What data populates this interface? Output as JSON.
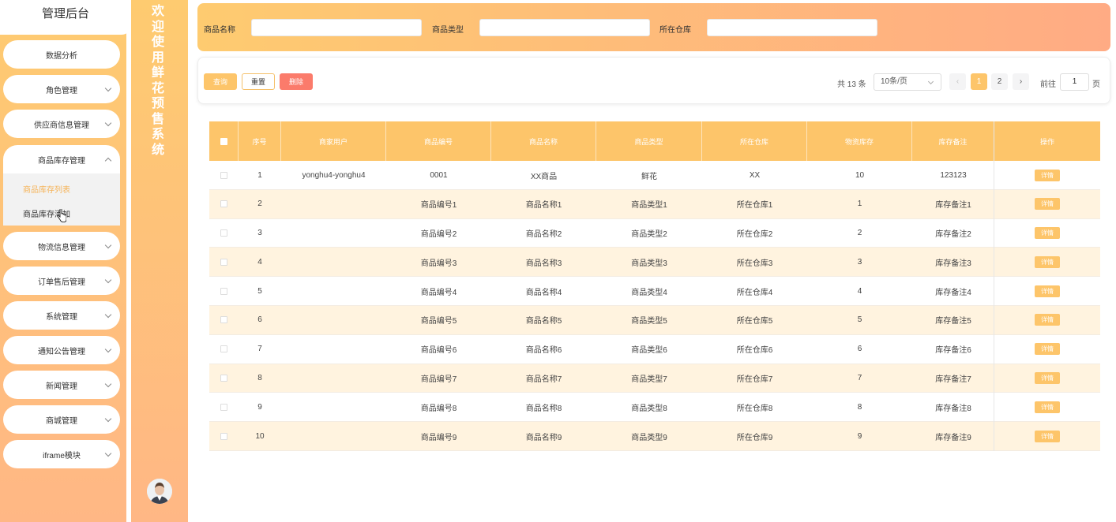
{
  "sidebar": {
    "title": "管理后台",
    "menu": [
      {
        "label": "数据分析",
        "chevron": false
      },
      {
        "label": "角色管理",
        "chevron": true
      },
      {
        "label": "供应商信息管理",
        "chevron": true
      },
      {
        "label": "商品库存管理",
        "chevron": true,
        "open": true
      },
      {
        "label": "物流信息管理",
        "chevron": true
      },
      {
        "label": "订单售后管理",
        "chevron": true
      },
      {
        "label": "系统管理",
        "chevron": true
      },
      {
        "label": "通知公告管理",
        "chevron": true
      },
      {
        "label": "新闻管理",
        "chevron": true
      },
      {
        "label": "商城管理",
        "chevron": true
      },
      {
        "label": "iframe模块",
        "chevron": true
      }
    ],
    "submenu": {
      "active": "商品库存列表",
      "normal": "商品库存添加"
    }
  },
  "welcome": {
    "text": "欢迎使用鲜花预售系统"
  },
  "search": {
    "name_label": "商品名称",
    "type_label": "商品类型",
    "warehouse_label": "所在仓库",
    "name_value": "",
    "type_value": "",
    "warehouse_value": ""
  },
  "toolbar": {
    "query_label": "查询",
    "reset_label": "重置",
    "delete_label": "删除"
  },
  "pagination": {
    "total": "共 13 条",
    "page_size": "10条/页",
    "prev": "‹",
    "pages": [
      "1",
      "2"
    ],
    "current_page": "1",
    "next": "›",
    "goto_label": "前往",
    "goto_value": "1",
    "page_unit": "页"
  },
  "table": {
    "headers": [
      "序号",
      "商家用户",
      "商品编号",
      "商品名称",
      "商品类型",
      "所在仓库",
      "物资库存",
      "库存备注",
      "操作"
    ],
    "detail_label": "详情",
    "rows": [
      [
        "1",
        "yonghu4-yonghu4",
        "0001",
        "XX商品",
        "鲜花",
        "XX",
        "10",
        "123123"
      ],
      [
        "2",
        "",
        "商品编号1",
        "商品名称1",
        "商品类型1",
        "所在仓库1",
        "1",
        "库存备注1"
      ],
      [
        "3",
        "",
        "商品编号2",
        "商品名称2",
        "商品类型2",
        "所在仓库2",
        "2",
        "库存备注2"
      ],
      [
        "4",
        "",
        "商品编号3",
        "商品名称3",
        "商品类型3",
        "所在仓库3",
        "3",
        "库存备注3"
      ],
      [
        "5",
        "",
        "商品编号4",
        "商品名称4",
        "商品类型4",
        "所在仓库4",
        "4",
        "库存备注4"
      ],
      [
        "6",
        "",
        "商品编号5",
        "商品名称5",
        "商品类型5",
        "所在仓库5",
        "5",
        "库存备注5"
      ],
      [
        "7",
        "",
        "商品编号6",
        "商品名称6",
        "商品类型6",
        "所在仓库6",
        "6",
        "库存备注6"
      ],
      [
        "8",
        "",
        "商品编号7",
        "商品名称7",
        "商品类型7",
        "所在仓库7",
        "7",
        "库存备注7"
      ],
      [
        "9",
        "",
        "商品编号8",
        "商品名称8",
        "商品类型8",
        "所在仓库8",
        "8",
        "库存备注8"
      ],
      [
        "10",
        "",
        "商品编号9",
        "商品名称9",
        "商品类型9",
        "所在仓库9",
        "9",
        "库存备注9"
      ]
    ]
  },
  "colors": {
    "accent": "#fdc56a",
    "danger": "#fb7b6b",
    "row_alt": "#fff3df",
    "submenu_active": "#f5b45a"
  }
}
